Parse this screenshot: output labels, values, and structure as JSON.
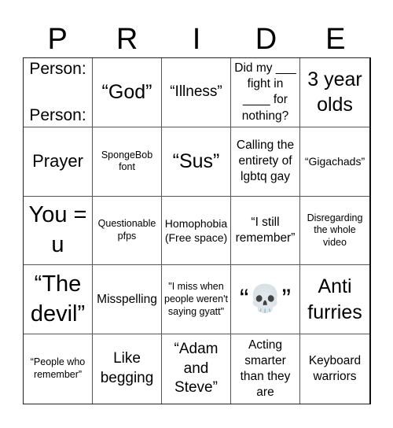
{
  "title_letters": [
    "P",
    "R",
    "I",
    "D",
    "E"
  ],
  "cells": [
    {
      "text": "Person:\nPerson:",
      "lines": [
        "Person:",
        "Person:"
      ]
    },
    {
      "text": "“God”"
    },
    {
      "text": "“Illness”"
    },
    {
      "text": "Did my ___ fight in ____ for nothing?"
    },
    {
      "text": "3 year olds"
    },
    {
      "text": "Prayer"
    },
    {
      "text": "SpongeBob font"
    },
    {
      "text": "“Sus”"
    },
    {
      "text": "Calling the entirety of lgbtq gay"
    },
    {
      "text": "“Gigachads”"
    },
    {
      "text": "You = u"
    },
    {
      "text": "Questionable pfps"
    },
    {
      "text": "Homophobia (Free space)"
    },
    {
      "text": "“I still remember”"
    },
    {
      "text": "Disregarding the whole video"
    },
    {
      "text": "“The devil”"
    },
    {
      "text": "Misspelling"
    },
    {
      "text": "\"I miss when people weren't saying gyatt\""
    },
    {
      "text": "“💀”",
      "icon": "skull-emoji"
    },
    {
      "text": "Anti furries"
    },
    {
      "text": "“People who remember”"
    },
    {
      "text": "Like begging"
    },
    {
      "text": "“Adam and Steve”"
    },
    {
      "text": "Acting smarter than they are"
    },
    {
      "text": "Keyboard warriors"
    }
  ]
}
